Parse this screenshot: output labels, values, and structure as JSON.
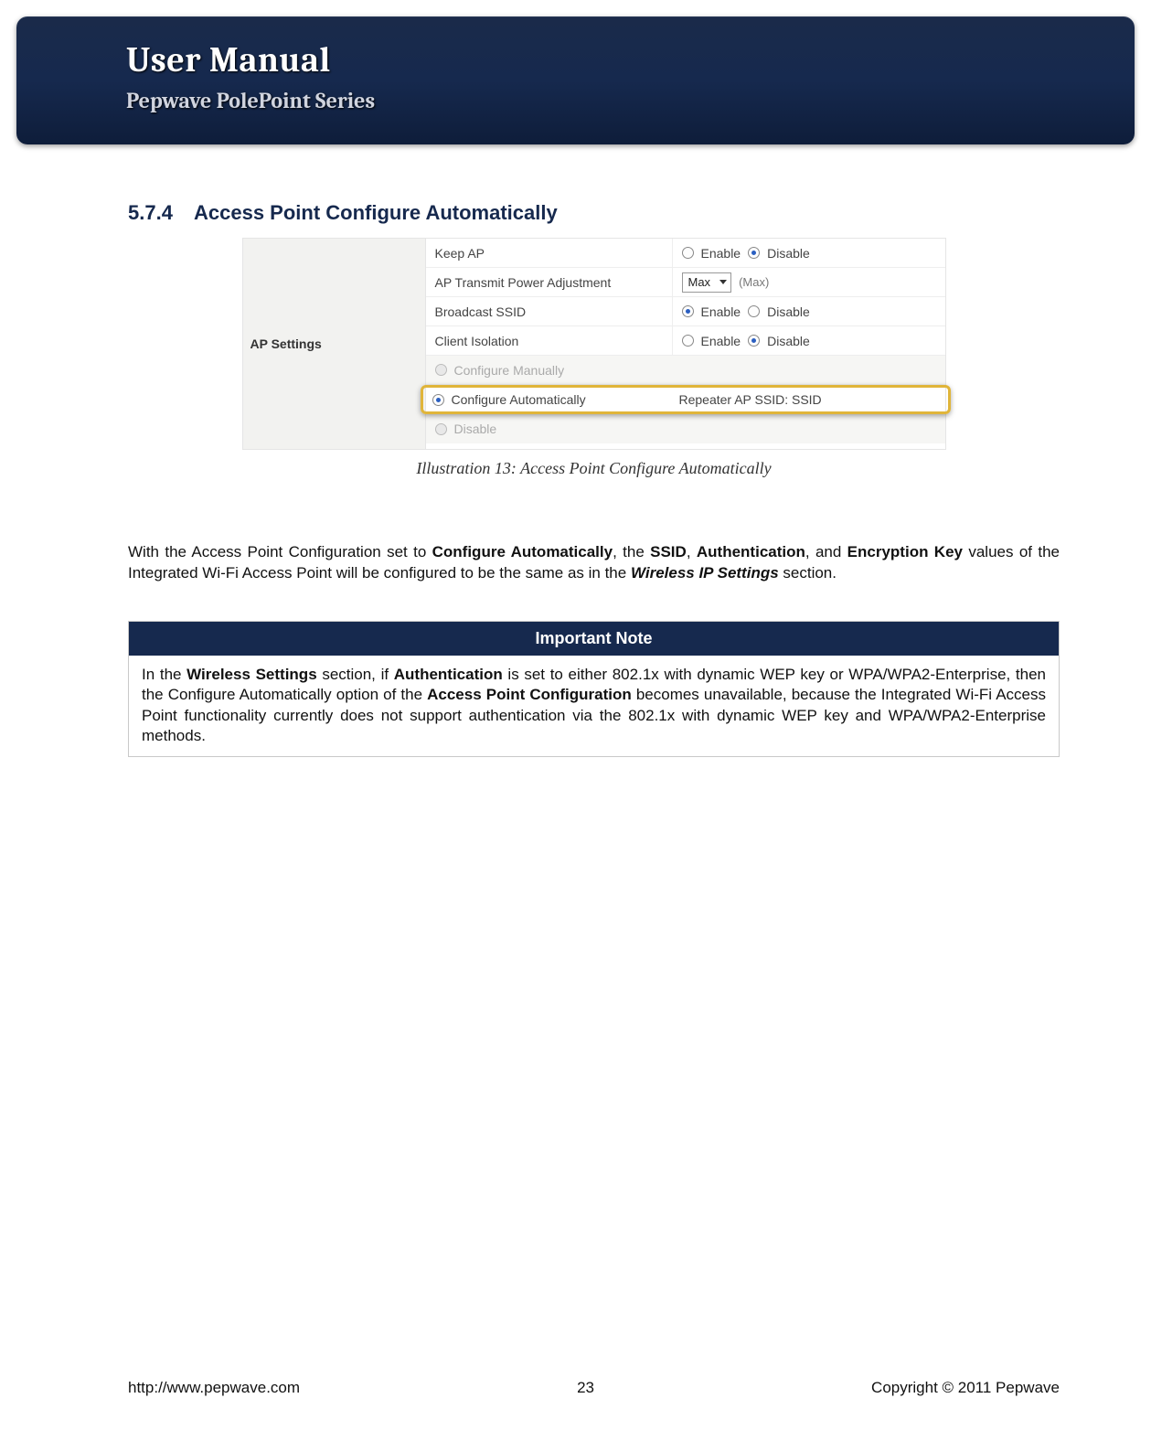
{
  "header": {
    "title": "User Manual",
    "subtitle": "Pepwave PolePoint Series"
  },
  "section": {
    "number": "5.7.4",
    "title": "Access Point Configure Automatically"
  },
  "ap_settings": {
    "panel_label": "AP Settings",
    "rows": {
      "keep_ap": {
        "label": "Keep AP",
        "enable": "Enable",
        "disable": "Disable",
        "selected": "disable"
      },
      "tx_power": {
        "label": "AP Transmit Power Adjustment",
        "value": "Max",
        "hint": "(Max)"
      },
      "broadcast_ssid": {
        "label": "Broadcast SSID",
        "enable": "Enable",
        "disable": "Disable",
        "selected": "enable"
      },
      "client_isolation": {
        "label": "Client Isolation",
        "enable": "Enable",
        "disable": "Disable",
        "selected": "disable"
      },
      "configure_manually": {
        "label": "Configure Manually"
      },
      "configure_auto": {
        "label": "Configure Automatically",
        "right": "Repeater AP SSID: SSID"
      },
      "disable_row": {
        "label": "Disable"
      }
    }
  },
  "figure_caption": "Illustration 13: Access Point Configure Automatically",
  "paragraph": {
    "p1": "With the Access Point Configuration set to ",
    "b1": "Configure Automatically",
    "p2": ", the ",
    "b2": "SSID",
    "p3": ", ",
    "b3": "Authentication",
    "p4": ", and ",
    "b4": "Encryption Key",
    "p5": " values of the Integrated Wi-Fi Access Point will be configured to be the same as in the ",
    "bi5": "Wireless IP Settings",
    "p6": " section."
  },
  "note": {
    "heading": "Important Note",
    "t1": "In the ",
    "b1": "Wireless Settings",
    "t2": " section, if ",
    "b2": "Authentication",
    "t3": " is set to either 802.1x with dynamic WEP key or WPA/WPA2-Enterprise, then the Configure Automatically option of the ",
    "b3": "Access Point Configuration",
    "t4": " becomes unavailable, because the Integrated Wi-Fi Access Point functionality currently does not support authentication via the 802.1x with dynamic WEP key and WPA/WPA2-Enterprise methods."
  },
  "footer": {
    "url": "http://www.pepwave.com",
    "page": "23",
    "copyright": "Copyright © 2011 Pepwave"
  }
}
